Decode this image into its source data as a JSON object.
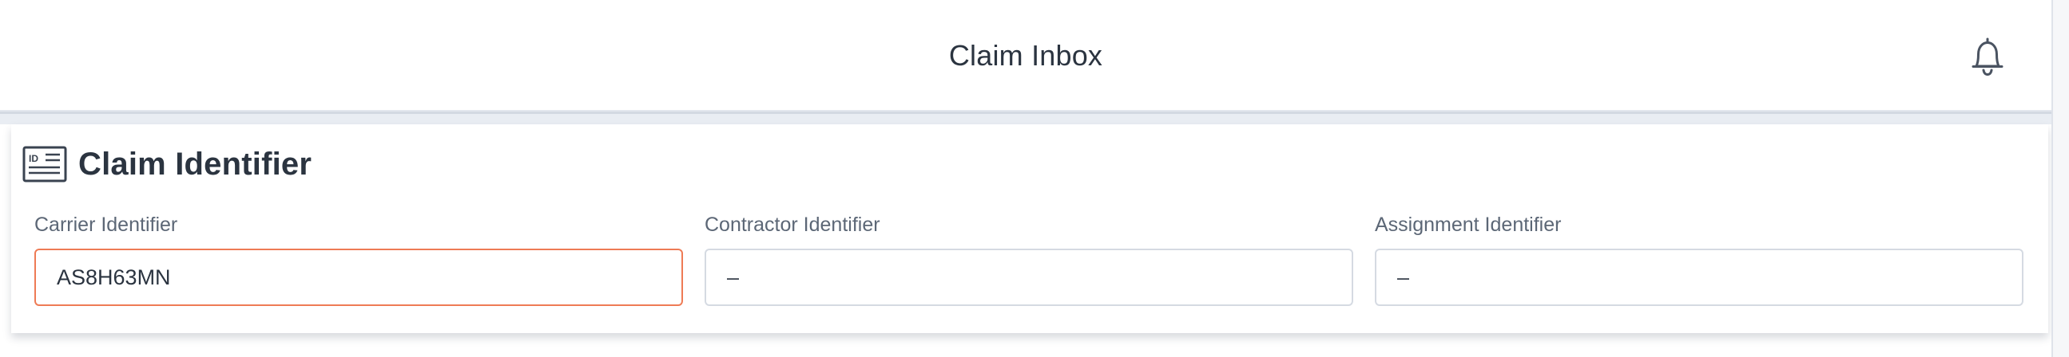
{
  "header": {
    "title": "Claim Inbox",
    "notification_icon": "bell-icon"
  },
  "section": {
    "title": "Claim Identifier",
    "icon": "id-card-icon"
  },
  "fields": {
    "carrier": {
      "label": "Carrier Identifier",
      "value": "AS8H63MN",
      "placeholder": "–",
      "focused": true
    },
    "contractor": {
      "label": "Contractor Identifier",
      "value": "",
      "placeholder": "–"
    },
    "assignment": {
      "label": "Assignment Identifier",
      "value": "",
      "placeholder": "–"
    }
  },
  "colors": {
    "focus_border": "#ee7b55",
    "input_border": "#d5dae2",
    "text": "#2b3440",
    "label": "#5c6776",
    "band": "#e9edf3"
  }
}
